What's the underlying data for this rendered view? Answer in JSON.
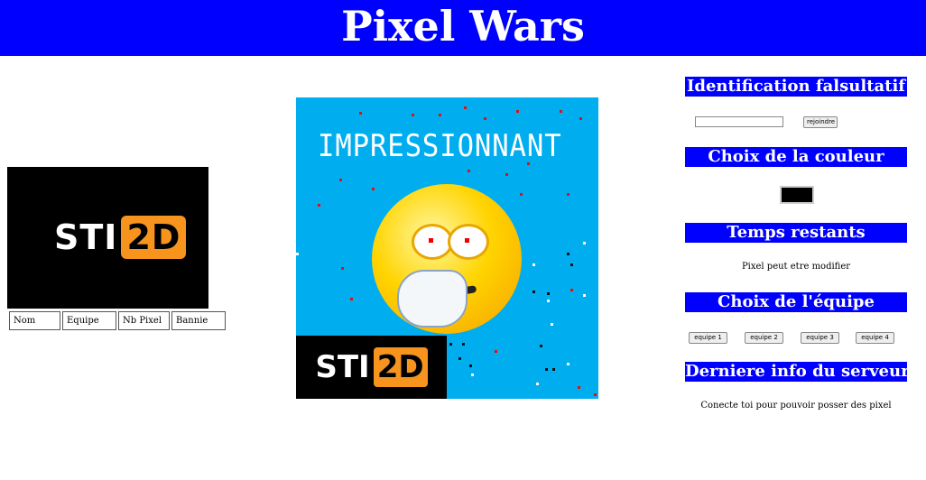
{
  "header": {
    "title": "Pixel Wars",
    "bg_color": "#0000ff"
  },
  "left": {
    "logo": {
      "text_white": "STI",
      "text_box": "2D",
      "accent": "#f7941d"
    },
    "table_headers": [
      "Nom",
      "Equipe",
      "Nb Pixel",
      "Bannie"
    ]
  },
  "canvas": {
    "title": "IMPRESSIONNANT",
    "logo": {
      "text_white": "STI",
      "text_box": "2D"
    },
    "bg_color": "#00adef"
  },
  "right": {
    "identification": {
      "title": "Identification falsultatif",
      "input_value": "",
      "join_label": "rejoindre"
    },
    "color": {
      "title": "Choix de la couleur",
      "selected": "#000000"
    },
    "time": {
      "title": "Temps restants",
      "status": "Pixel peut etre modifier"
    },
    "team": {
      "title": "Choix de l'équipe",
      "buttons": [
        "equipe 1",
        "equipe 2",
        "equipe 3",
        "equipe 4"
      ]
    },
    "server": {
      "title": "Derniere info du serveur",
      "message": "Conecte toi pour pouvoir posser des pixel"
    }
  }
}
